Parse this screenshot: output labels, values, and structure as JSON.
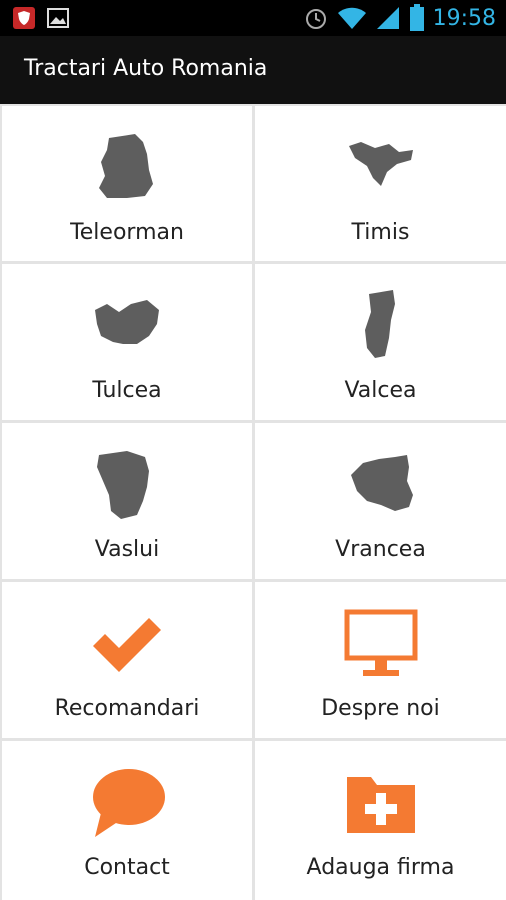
{
  "status_bar": {
    "time": "19:58",
    "icons": [
      "shield-notification-icon",
      "image-notification-icon",
      "alarm-icon",
      "wifi-icon",
      "signal-icon",
      "battery-icon"
    ],
    "accent": "#33b5e5"
  },
  "app_bar": {
    "title": "Tractari Auto Romania",
    "background": "#111111"
  },
  "tiles": [
    {
      "label": "Teleorman",
      "icon": "teleorman-map-icon"
    },
    {
      "label": "Timis",
      "icon": "timis-map-icon"
    },
    {
      "label": "Tulcea",
      "icon": "tulcea-map-icon"
    },
    {
      "label": "Valcea",
      "icon": "valcea-map-icon"
    },
    {
      "label": "Vaslui",
      "icon": "vaslui-map-icon"
    },
    {
      "label": "Vrancea",
      "icon": "vrancea-map-icon"
    },
    {
      "label": "Recomandari",
      "icon": "checkmark-icon"
    },
    {
      "label": "Despre noi",
      "icon": "monitor-icon"
    },
    {
      "label": "Contact",
      "icon": "speech-bubble-icon"
    },
    {
      "label": "Adauga firma",
      "icon": "add-folder-icon"
    }
  ],
  "colors": {
    "map_gray": "#5e5e5e",
    "accent_orange": "#f47a32",
    "grid_gap": "#e3e3e3"
  }
}
